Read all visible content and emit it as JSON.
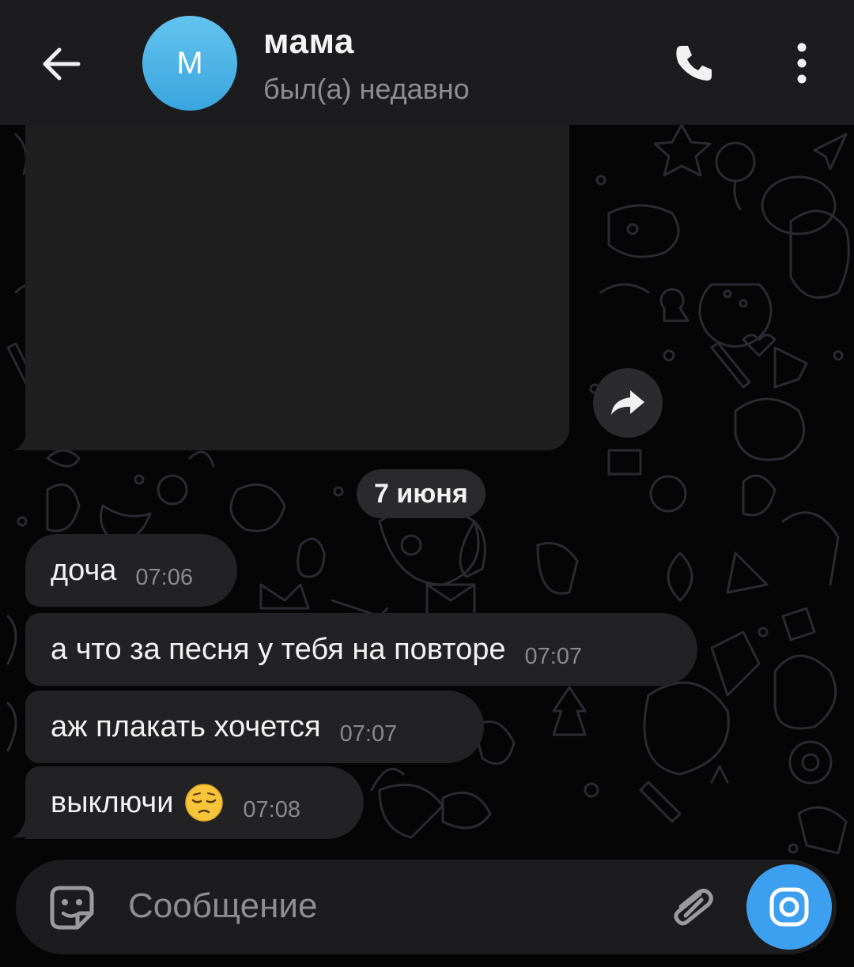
{
  "header": {
    "back_icon": "arrow-left-icon",
    "avatar_letter": "М",
    "title": "мама",
    "status": "был(а) недавно",
    "call_icon": "phone-icon",
    "menu_icon": "more-vertical-icon"
  },
  "colors": {
    "header_bg": "#1c1c1e",
    "bubble_bg": "#222224",
    "accent": "#3c9ff0",
    "avatar": "#4fb3e8"
  },
  "chat": {
    "share_icon": "share-arrow-icon",
    "date_separator": "7 июня",
    "messages": [
      {
        "text": "доча",
        "time": "07:06"
      },
      {
        "text": "а что за песня у тебя на повторе",
        "time": "07:07"
      },
      {
        "text": "аж плакать хочется",
        "time": "07:07"
      },
      {
        "text": "выключи",
        "emoji": "😔",
        "time": "07:08"
      }
    ]
  },
  "composer": {
    "sticker_icon": "sticker-icon",
    "placeholder": "Сообщение",
    "attach_icon": "paperclip-icon",
    "camera_icon": "camera-icon"
  }
}
